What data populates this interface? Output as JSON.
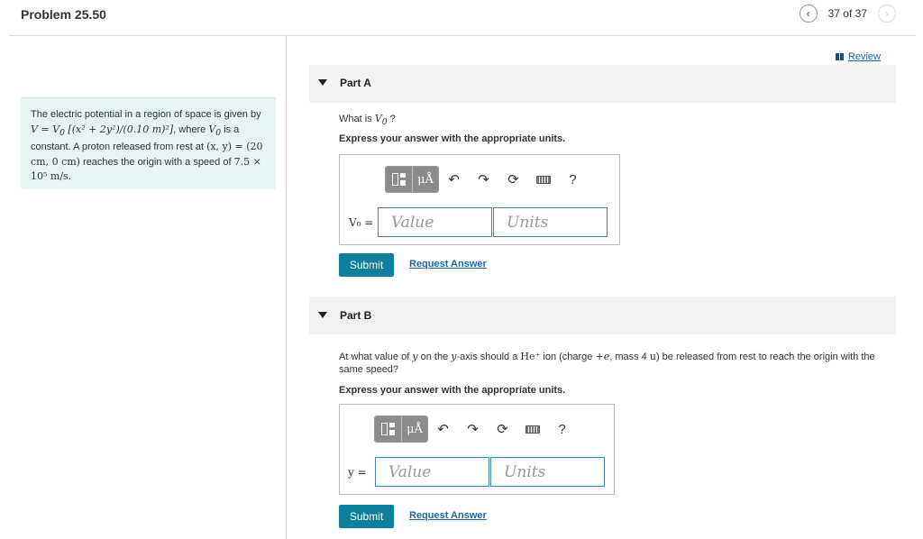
{
  "header": {
    "title": "Problem 25.50",
    "page_count": "37 of 37"
  },
  "review": {
    "label": "Review"
  },
  "problem": {
    "text_1": "The electric potential in a region of space is given by",
    "eq_V": "V = V",
    "eq_sub0": "0",
    "eq_rest": " [(x² + 2y²)/(0.10 m)²]",
    "text_2": ", where ",
    "V0": "V",
    "V0_sub": "0",
    "text_3": " is a constant. A proton released from rest at",
    "coords": "(x, y) = (20 cm, 0 cm)",
    "text_4": " reaches the origin with a speed of ",
    "speed": "7.5 × 10⁵ m/s."
  },
  "part_a": {
    "label": "Part A",
    "question_prefix": "What is ",
    "question_var": "V",
    "question_sub": "0",
    "question_suffix": " ?",
    "instruction": "Express your answer with the appropriate units.",
    "answer_label": "V₀ =",
    "value_placeholder": "Value",
    "units_placeholder": "Units",
    "submit": "Submit",
    "request_answer": "Request Answer"
  },
  "part_b": {
    "label": "Part B",
    "question_1": "At what value of ",
    "question_y": "y",
    "question_2": " on the ",
    "question_yaxis": "y",
    "question_3": "-axis should a ",
    "question_ion": "He⁺",
    "question_4": " ion (charge ",
    "question_charge": "+e",
    "question_5": ", mass 4 ",
    "question_u": "u",
    "question_6": ") be released from rest to reach the origin with the same speed?",
    "instruction": "Express your answer with the appropriate units.",
    "answer_label": "y =",
    "value_placeholder": "Value",
    "units_placeholder": "Units",
    "submit": "Submit",
    "request_answer": "Request Answer"
  },
  "toolbar": {
    "units_btn": "μÅ",
    "undo": "↶",
    "redo": "↷",
    "reset": "⟳",
    "help": "?"
  }
}
